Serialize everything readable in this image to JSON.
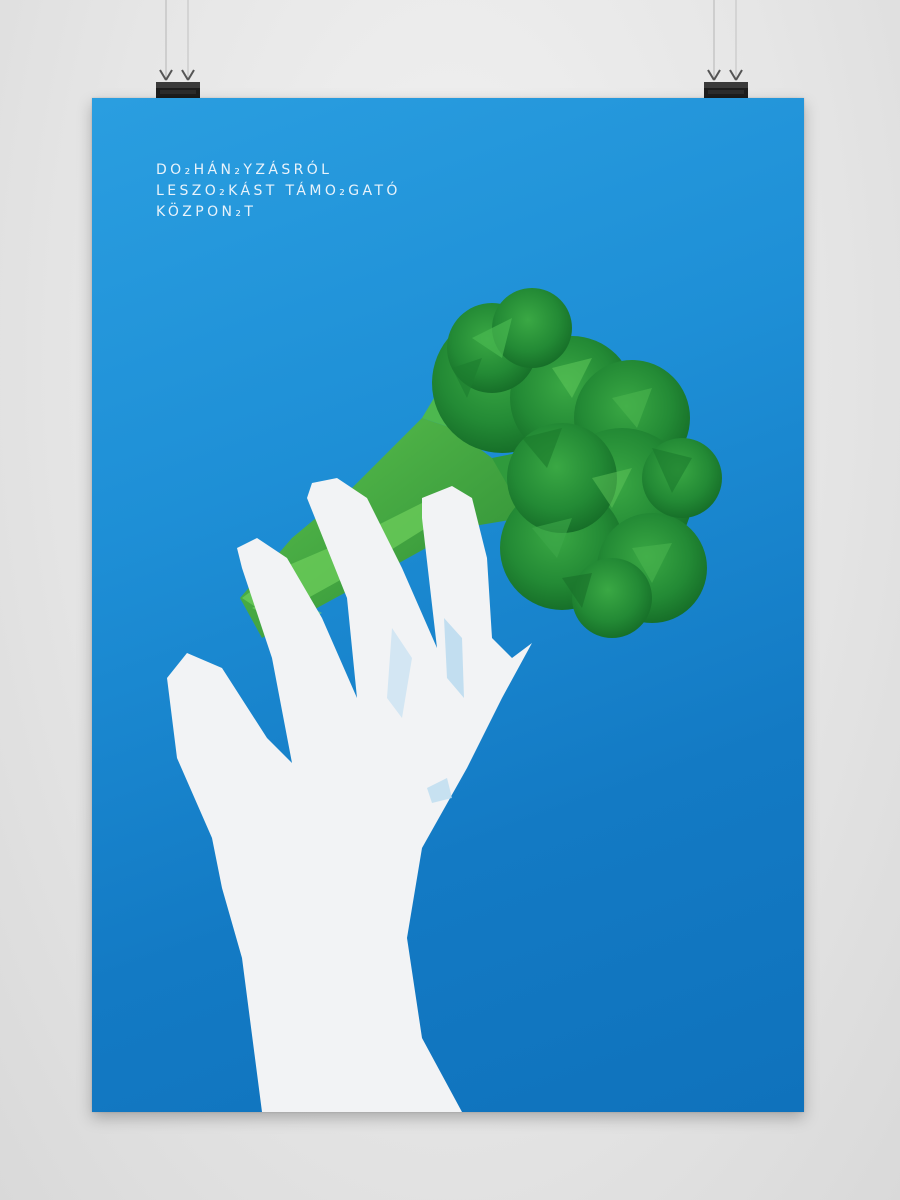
{
  "poster": {
    "background_color": "#1e8fd6",
    "headline": {
      "line1": "DO₂HÁN₂YZÁSRÓL",
      "line2": "LESZO₂KÁST TÁMO₂GATÓ",
      "line3": "KÖZPON₂T"
    },
    "illustration": {
      "subject": "white-hand-holding-broccoli",
      "broccoli_color": "#2e9a3a",
      "hand_color": "#f2f2f2"
    }
  },
  "hangers": {
    "left": "binder-clip-icon",
    "right": "binder-clip-icon"
  }
}
